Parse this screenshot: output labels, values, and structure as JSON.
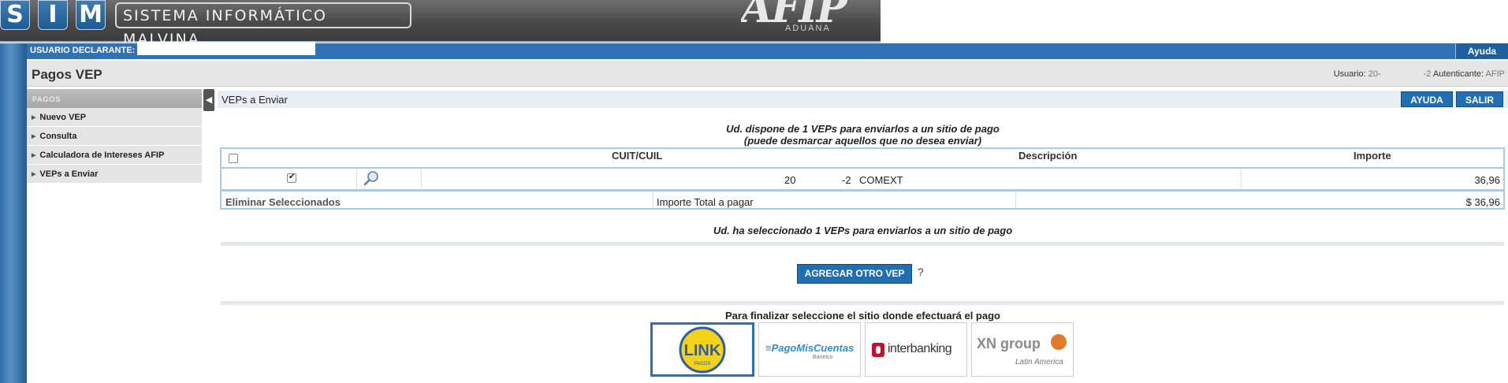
{
  "banner": {
    "letters": [
      "S",
      "I",
      "M"
    ],
    "system_title": "SISTEMA INFORMÁTICO MALVINA",
    "logo_text": "AFIP",
    "logo_subtext": "ADUANA"
  },
  "userbar": {
    "declarant_label": "USUARIO DECLARANTE: 20",
    "help_label": "Ayuda"
  },
  "titlebar": {
    "page_title": "Pagos VEP",
    "user_label": "Usuario: ",
    "user_value_prefix": "20-",
    "user_value_suffix": "-2",
    "auth_label": " Autenticante: ",
    "auth_value": "AFIP"
  },
  "sidebar": {
    "header": "PAGOS",
    "items": [
      {
        "label": "Nuevo VEP"
      },
      {
        "label": "Consulta"
      },
      {
        "label": "Calculadora de Intereses AFIP"
      },
      {
        "label": "VEPs a Enviar"
      }
    ]
  },
  "main": {
    "section_title": "VEPs a Enviar",
    "help_button": "AYUDA",
    "exit_button": "SALIR",
    "info_line1": "Ud. dispone de 1 VEPs para enviarlos a un sitio de pago",
    "info_line2": "(puede desmarcar aquellos que no desea enviar)",
    "columns": [
      "CUIT/CUIL",
      "Descripción",
      "Importe"
    ],
    "rows": [
      {
        "checked": true,
        "cuit_prefix": "20",
        "cuit_suffix": "-2",
        "description": "COMEXT",
        "amount": "36,96"
      }
    ],
    "delete_selected": "Eliminar Seleccionados",
    "total_label": "Importe Total a pagar",
    "total_value": "$ 36,96",
    "selected_msg": "Ud. ha seleccionado 1 VEPs para enviarlos a un sitio de pago",
    "add_button": "AGREGAR OTRO VEP",
    "add_help": "?",
    "finalize_msg": "Para finalizar seleccione el sitio donde efectuará el pago"
  },
  "payment_sites": [
    {
      "name": "LINK",
      "sub": "PAGOS",
      "selected": true
    },
    {
      "name": "PagoMisCuentas",
      "prefix": "≡",
      "sub": "Banelco",
      "selected": false
    },
    {
      "name": "interbanking",
      "selected": false
    },
    {
      "name": "XN group",
      "sub": "Latin America",
      "selected": false
    }
  ],
  "colors": {
    "accent_blue": "#1f6fb2",
    "userbar_blue": "#2f73b6",
    "table_border": "#a9cbe6",
    "link_yellow": "#f2d21a",
    "pmc_blue": "#2f8fd6",
    "interbanking_red": "#c8102e",
    "xn_orange": "#e27a2b"
  }
}
